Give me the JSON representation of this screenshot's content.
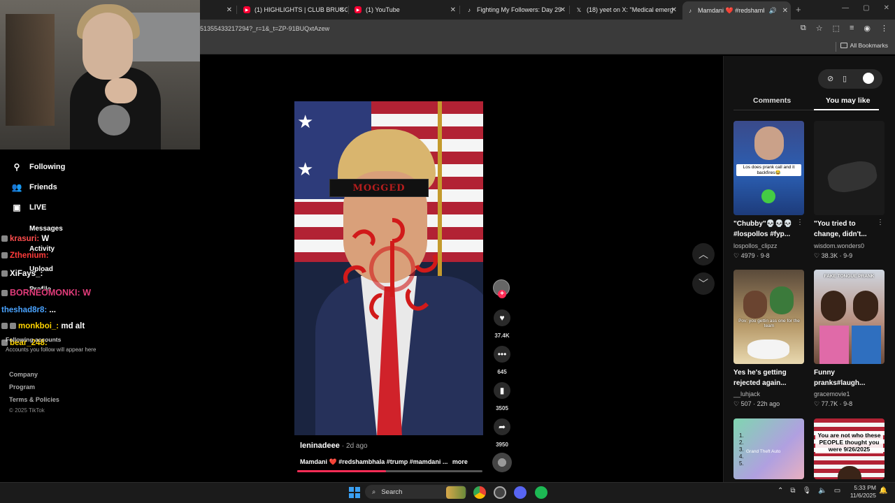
{
  "browser": {
    "tabs": [
      {
        "title": "(1) HIGHLIGHTS | CLUB BRUGG",
        "favicon": "youtube-icon"
      },
      {
        "title": "(1) YouTube",
        "favicon": "youtube-icon"
      },
      {
        "title": "Fighting My Followers: Day 29",
        "favicon": "tiktok-icon"
      },
      {
        "title": "(18) yeet on X: \"Medical emerg",
        "favicon": "x-icon"
      },
      {
        "title": "Mamdani ❤️ #redshambha",
        "favicon": "tiktok-icon"
      }
    ],
    "url": "51355433217294?_r=1&_t=ZP-91BUQxtAzew",
    "bookmarks_label": "All Bookmarks"
  },
  "tiktok": {
    "nav": {
      "following": "Following",
      "friends": "Friends",
      "live": "LIVE",
      "messages": "Messages",
      "activity": "Activity",
      "upload": "Upload",
      "profile": "Profile"
    },
    "following_accounts_title": "Following accounts",
    "following_accounts_sub": "Accounts you follow will appear here",
    "footer": {
      "company": "Company",
      "program": "Program",
      "terms": "Terms & Policies",
      "copyright": "© 2025 TikTok"
    },
    "chat": [
      {
        "user": "krasuri:",
        "msg": "W",
        "color": "#ff4d4d"
      },
      {
        "user": "Zthenium:",
        "msg": "",
        "color": "#ff3b3b"
      },
      {
        "user": "XiFays_:",
        "msg": "",
        "color": "#ffffff"
      },
      {
        "user": "BORNEOMONKI:",
        "msg": "W",
        "color": "#e23c7a"
      },
      {
        "user": "theshad8r8:",
        "msg": "...",
        "color": "#4aa3ff"
      },
      {
        "user": "monkboi_:",
        "msg": "md alt",
        "color": "#ffd400"
      },
      {
        "user": "bear_248:",
        "msg": "",
        "color": "#ffd400"
      }
    ],
    "video": {
      "overlay_text": "MOGGED",
      "author": "leninadeee",
      "date": "2d ago",
      "caption_prefix": "Mamdani",
      "caption_heart": "❤️",
      "caption_tags": "#redshambhala #trump #mamdani ...",
      "more_label": "more",
      "progress": 0.48
    },
    "actions": {
      "likes": "37.4K",
      "comments": "645",
      "saves": "3505",
      "shares": "3950"
    },
    "panel": {
      "tab_comments": "Comments",
      "tab_you_may_like": "You may like",
      "cards": [
        {
          "title": "\"Chubby\"💀💀💀 #lospollos #fyp...",
          "user": "lospollos_clipzz",
          "likes": "4979",
          "date": "9-8",
          "thumb_text": "Los does prank call and it backfires😂"
        },
        {
          "title": "\"You tried to change, didn't...",
          "user": "wisdom.wonders0",
          "likes": "38.3K",
          "date": "9-9",
          "thumb_text": ""
        },
        {
          "title": "Yes he's getting rejected again...",
          "user": "__luhjack",
          "likes": "507",
          "date": "22h ago",
          "thumb_text": "Pov: you gettin ass one for the team"
        },
        {
          "title": "Funny pranks#laugh...",
          "user": "gracemovie1",
          "likes": "77.7K",
          "date": "9-8",
          "thumb_text": "FAKE TONGUE PRANK"
        },
        {
          "title": "",
          "user": "",
          "likes": "",
          "date": "",
          "thumb_text": "Grand Theft Auto"
        },
        {
          "title": "",
          "user": "",
          "likes": "",
          "date": "",
          "thumb_text": "You are not who these PEOPLE thought you were 9/26/2025"
        }
      ]
    }
  },
  "taskbar": {
    "search_placeholder": "Search",
    "time": "5:33 PM",
    "date": "11/6/2025"
  },
  "colors": {
    "accent": "#fe2c55",
    "panel_bg": "#121212"
  }
}
